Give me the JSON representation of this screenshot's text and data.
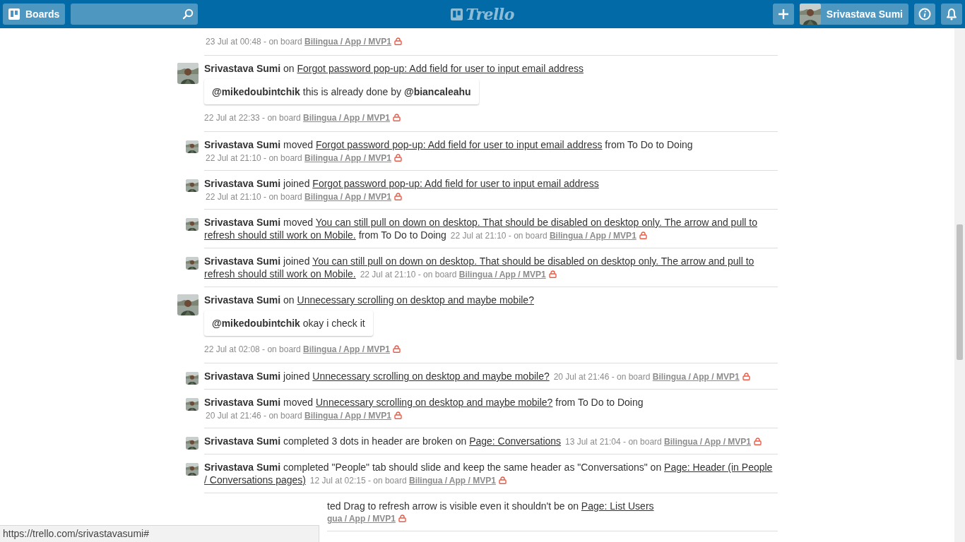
{
  "header": {
    "boards_label": "Boards",
    "logo_text": "Trello",
    "user_name": "Srivastava Sumi"
  },
  "feed": [
    {
      "kind": "meta",
      "time": "23 Jul at 00:48 - on board",
      "board": "Bilingua / App / MVP1"
    },
    {
      "kind": "comment",
      "actor": "Srivastava Sumi",
      "action": "on",
      "card": "Forgot password pop-up: Add field for user to input email address",
      "comment": "**@mikedoubintchik** this is already done by **@biancaleahu**",
      "time": "22 Jul at 22:33 - on board",
      "board": "Bilingua / App / MVP1"
    },
    {
      "kind": "action",
      "actor": "Srivastava Sumi",
      "action": "moved",
      "card": "Forgot password pop-up: Add field for user to input email address",
      "after": "from To Do to Doing",
      "time": "22 Jul at 21:10 - on board",
      "board": "Bilingua / App / MVP1"
    },
    {
      "kind": "action",
      "actor": "Srivastava Sumi",
      "action": "joined",
      "card": "Forgot password pop-up: Add field for user to input email address",
      "time": "22 Jul at 21:10 - on board",
      "board": "Bilingua / App / MVP1"
    },
    {
      "kind": "action",
      "actor": "Srivastava Sumi",
      "action": "moved",
      "card": "You can still pull on down on desktop. That should be disabled on desktop only. The arrow and pull to refresh should still work on Mobile.",
      "after": "from To Do to Doing",
      "time": "22 Jul at 21:10 - on board",
      "board": "Bilingua / App / MVP1"
    },
    {
      "kind": "action",
      "actor": "Srivastava Sumi",
      "action": "joined",
      "card": "You can still pull on down on desktop. That should be disabled on desktop only. The arrow and pull to refresh should still work on Mobile.",
      "time": "22 Jul at 21:10 - on board",
      "board": "Bilingua / App / MVP1"
    },
    {
      "kind": "comment",
      "actor": "Srivastava Sumi",
      "action": "on",
      "card": "Unnecessary scrolling on desktop and maybe mobile?",
      "comment": "**@mikedoubintchik** okay i check it",
      "time": "22 Jul at 02:08 - on board",
      "board": "Bilingua / App / MVP1"
    },
    {
      "kind": "action",
      "actor": "Srivastava Sumi",
      "action": "joined",
      "card": "Unnecessary scrolling on desktop and maybe mobile?",
      "time": "20 Jul at 21:46 - on board",
      "board": "Bilingua / App / MVP1"
    },
    {
      "kind": "action",
      "actor": "Srivastava Sumi",
      "action": "moved",
      "card": "Unnecessary scrolling on desktop and maybe mobile?",
      "after": "from To Do to Doing",
      "time": "20 Jul at 21:46 - on board",
      "board": "Bilingua / App / MVP1"
    },
    {
      "kind": "action",
      "actor": "Srivastava Sumi",
      "action": "completed 3 dots in header are broken on",
      "card": "Page: Conversations",
      "time": "13 Jul at 21:04 - on board",
      "board": "Bilingua / App / MVP1"
    },
    {
      "kind": "action",
      "actor": "Srivastava Sumi",
      "action": "completed \"People\" tab should slide and keep the same header as \"Conversations\" on",
      "card": "Page: Header (in People / Conversations pages)",
      "time": "12 Jul at 02:15 - on board",
      "board": "Bilingua / App / MVP1"
    },
    {
      "kind": "covered",
      "action": "ted Drag to refresh arrow is visible even it shouldn't be on",
      "card": "Page: List Users",
      "board": "gua / App / MVP1"
    }
  ],
  "status_bar": {
    "url": "https://trello.com/srivastavasumi#"
  }
}
